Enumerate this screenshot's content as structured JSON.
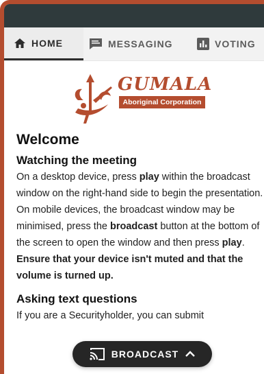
{
  "tabs": [
    {
      "label": "HOME",
      "icon": "home-icon"
    },
    {
      "label": "MESSAGING",
      "icon": "message-icon"
    },
    {
      "label": "VOTING",
      "icon": "bar-chart-icon"
    }
  ],
  "logo": {
    "name": "GUMALA",
    "subtitle": "Aboriginal Corporation"
  },
  "content": {
    "title": "Welcome",
    "section1": {
      "heading": "Watching the meeting",
      "t1": "On a desktop device, press ",
      "b1": "play",
      "t2": " within the broadcast window on the right-hand side to begin the presentation. On mobile devices, the broadcast window may be minimised, press the ",
      "b2": "broadcast",
      "t3": " button at the bottom of the screen to open the window and then press ",
      "b3": "play",
      "t4": ". ",
      "b4": "Ensure that your device isn't muted and that the volume is turned up."
    },
    "section2": {
      "heading": "Asking text questions",
      "text": "If you are a Securityholder, you can submit"
    }
  },
  "broadcast_button": {
    "label": "BROADCAST",
    "icon": "cast-icon"
  },
  "colors": {
    "accent": "#b44d2f",
    "topbar": "#2f3a3c",
    "button_bg": "#262626"
  }
}
